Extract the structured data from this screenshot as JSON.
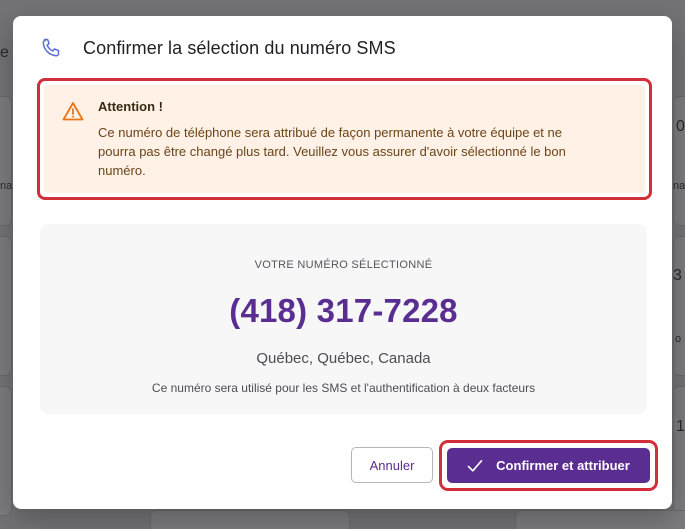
{
  "background": {
    "snippets": [
      "e",
      "0",
      "na",
      "nad",
      "3",
      "o",
      "1"
    ]
  },
  "modal": {
    "title": "Confirmer la sélection du numéro SMS",
    "header_icon": "phone-icon",
    "warning": {
      "icon": "warning-triangle-icon",
      "title": "Attention !",
      "body_line1": "Ce numéro de téléphone sera attribué de façon permanente à votre équipe et ne",
      "body_line2": "pourra pas être changé plus tard. Veuillez vous assurer d'avoir sélectionné le bon",
      "body_line3": "numéro."
    },
    "selection": {
      "label": "VOTRE NUMÉRO SÉLECTIONNÉ",
      "number": "(418) 317-7228",
      "location": "Québec, Québec, Canada",
      "note": "Ce numéro sera utilisé pour les SMS et l'authentification à deux facteurs"
    },
    "buttons": {
      "cancel": "Annuler",
      "confirm": "Confirmer et attribuer",
      "confirm_icon": "check-icon"
    }
  },
  "colors": {
    "accent": "#5a2e91",
    "highlight_outline": "#d12f3a",
    "warning_bg": "#fff1e6",
    "warning_icon": "#e8741a",
    "phone_icon": "#5b6fd6"
  }
}
